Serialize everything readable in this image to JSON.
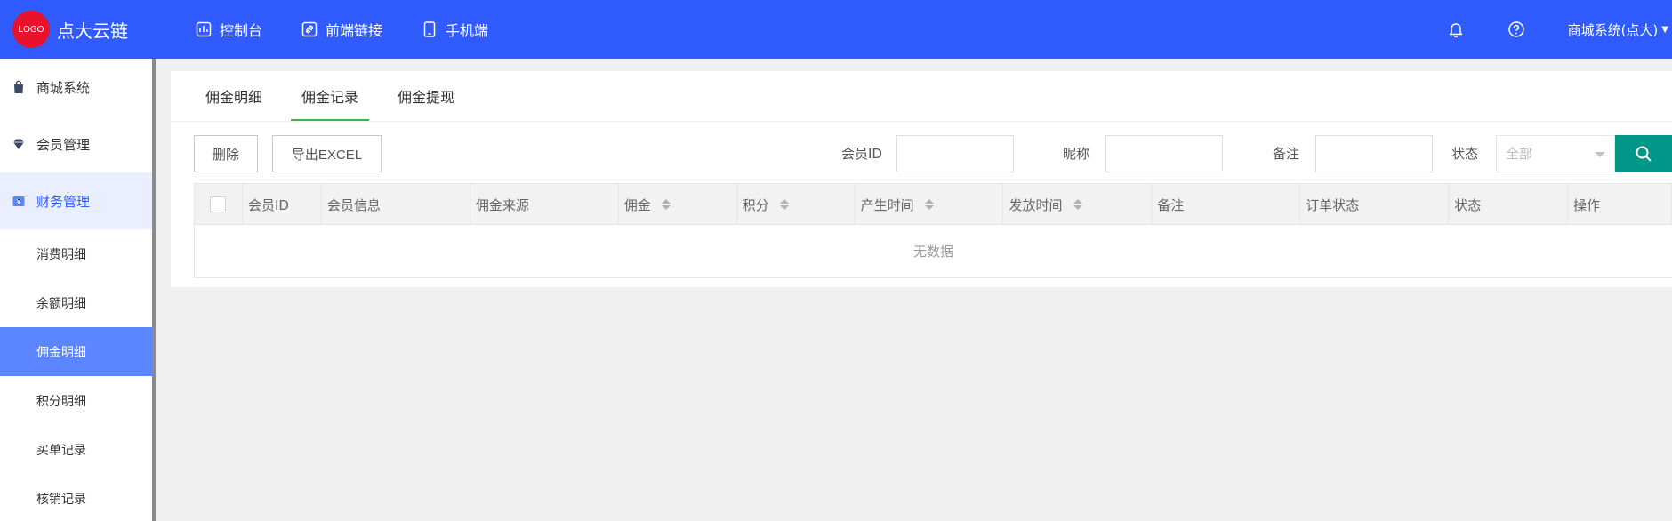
{
  "header": {
    "logo_badge": "LOGO",
    "app_name": "点大云链",
    "nav": [
      {
        "label": "控制台",
        "icon": "dashboard-icon"
      },
      {
        "label": "前端链接",
        "icon": "link-icon"
      },
      {
        "label": "手机端",
        "icon": "mobile-icon"
      }
    ],
    "user_label": "商城系统(点大)",
    "bg_color": "#2f5bff"
  },
  "sidebar": {
    "groups": [
      {
        "label": "商城系统",
        "icon": "shopping-bag-icon"
      },
      {
        "label": "会员管理",
        "icon": "diamond-icon"
      },
      {
        "label": "财务管理",
        "icon": "wallet-icon",
        "active": true
      }
    ],
    "sub_items": [
      {
        "label": "消费明细"
      },
      {
        "label": "余额明细"
      },
      {
        "label": "佣金明细",
        "selected": true
      },
      {
        "label": "积分明细"
      },
      {
        "label": "买单记录"
      },
      {
        "label": "核销记录"
      }
    ]
  },
  "tabs": [
    {
      "label": "佣金明细"
    },
    {
      "label": "佣金记录",
      "active": true
    },
    {
      "label": "佣金提现"
    }
  ],
  "toolbar": {
    "delete_label": "删除",
    "export_label": "导出EXCEL"
  },
  "filters": {
    "member_id_label": "会员ID",
    "nickname_label": "昵称",
    "remark_label": "备注",
    "status_label": "状态",
    "status_value": "全部"
  },
  "table": {
    "columns": [
      {
        "label": "会员ID",
        "sortable": false
      },
      {
        "label": "会员信息",
        "sortable": false
      },
      {
        "label": "佣金来源",
        "sortable": false
      },
      {
        "label": "佣金",
        "sortable": true
      },
      {
        "label": "积分",
        "sortable": true
      },
      {
        "label": "产生时间",
        "sortable": true
      },
      {
        "label": "发放时间",
        "sortable": true
      },
      {
        "label": "备注",
        "sortable": false
      },
      {
        "label": "订单状态",
        "sortable": false
      },
      {
        "label": "状态",
        "sortable": false
      },
      {
        "label": "操作",
        "sortable": false
      }
    ],
    "empty_text": "无数据"
  },
  "colors": {
    "accent": "#2f5bff",
    "tab_underline": "#3bb54a",
    "search_button": "#009688",
    "logo_red": "#e8132b"
  }
}
